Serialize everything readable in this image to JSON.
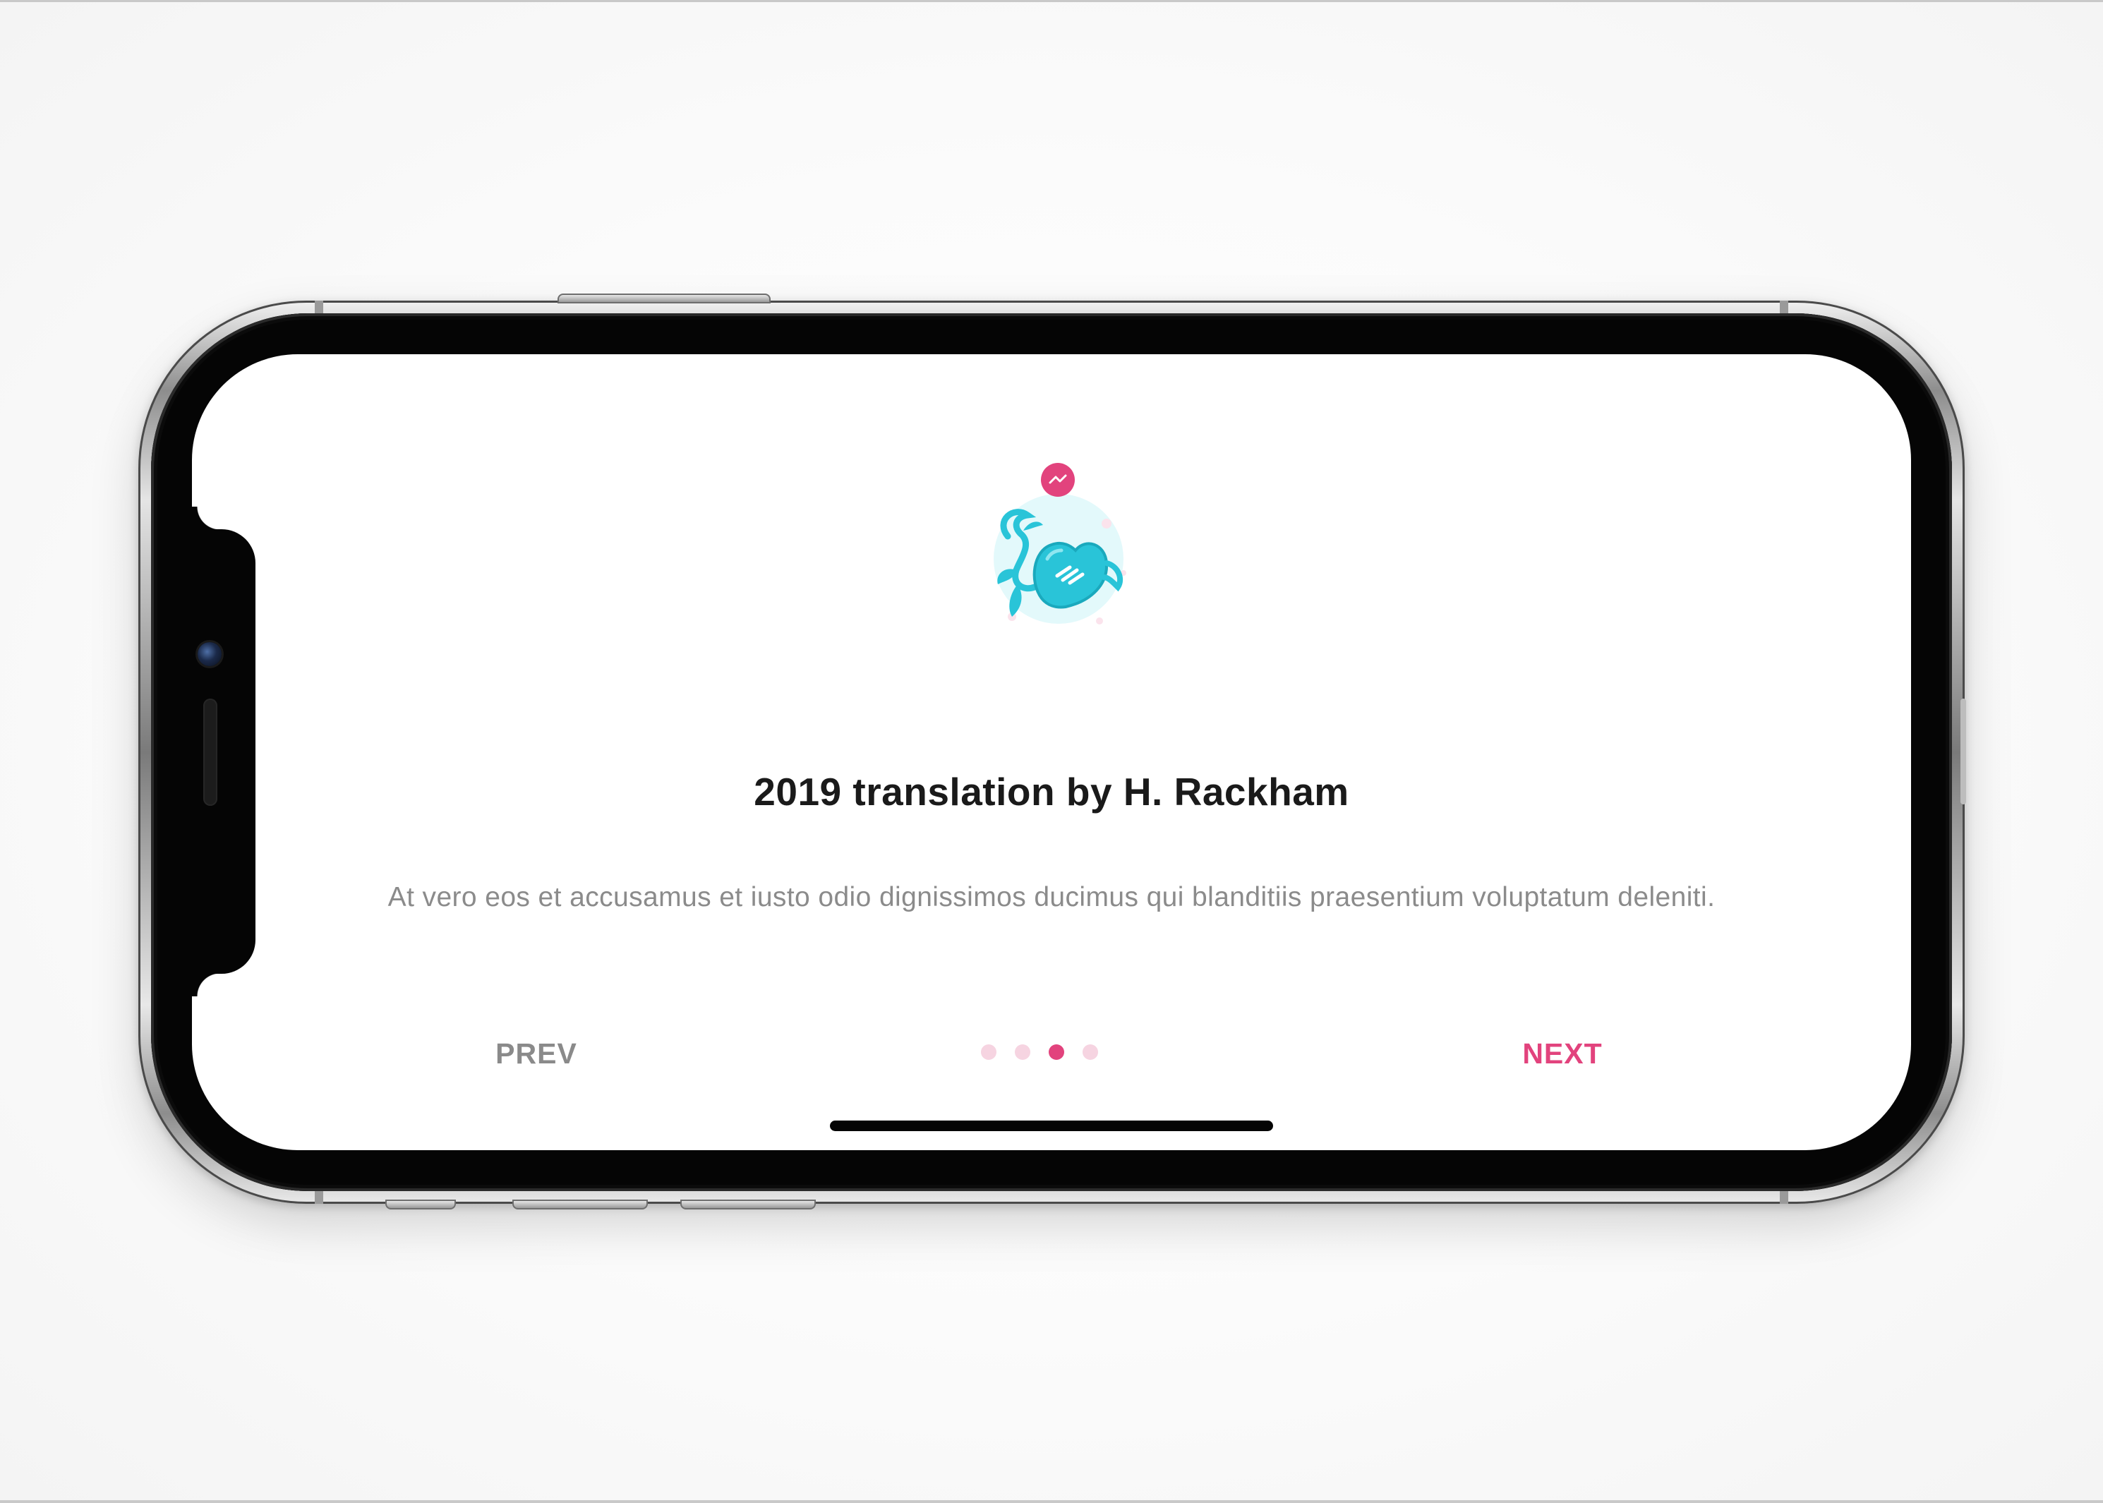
{
  "onboarding": {
    "title": "2019 translation by H. Rackham",
    "description": "At vero eos et accusamus et iusto odio dignissimos ducimus qui blanditiis praesentium voluptatum deleniti.",
    "illustration": "heart-plant-icon",
    "notification_icon": "lightning-icon",
    "prev_label": "PREV",
    "next_label": "NEXT",
    "pagination": {
      "total": 4,
      "active_index": 2
    }
  },
  "colors": {
    "accent": "#e2437d",
    "accent_light": "#f6d4e1",
    "illustration_teal": "#29c4d8",
    "illustration_bg": "#e3f9fb",
    "title": "#1a1a1a",
    "body": "#8b8b8b",
    "prev": "#8a8a8a"
  }
}
